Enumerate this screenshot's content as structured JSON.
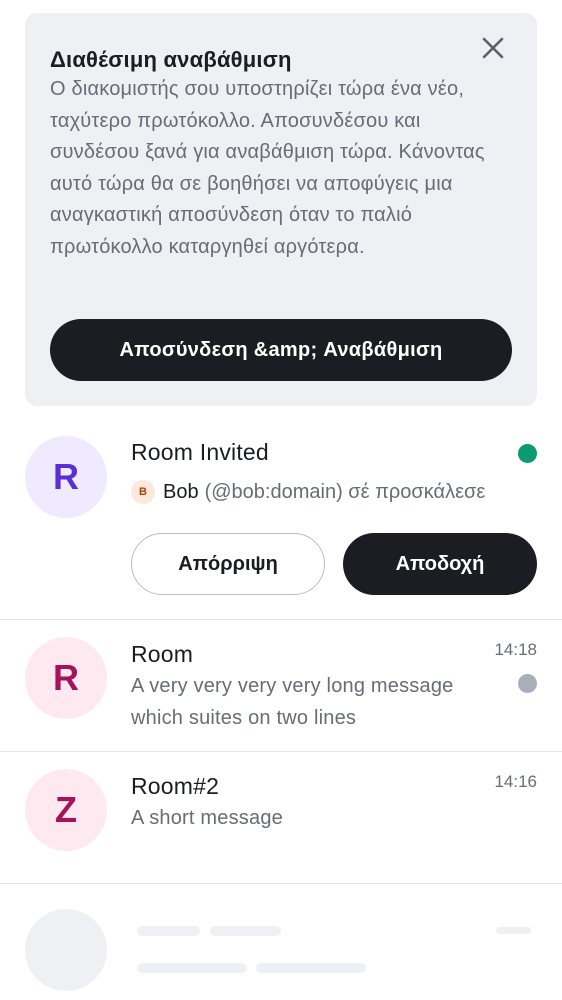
{
  "banner": {
    "title": "Διαθέσιμη αναβάθμιση",
    "body": "Ο διακομιστής σου υποστηρίζει τώρα ένα νέο, ταχύτερο πρωτόκολλο. Αποσυνδέσου και συνδέσου ξανά για αναβάθμιση τώρα. Κάνοντας αυτό τώρα θα σε βοηθήσει να αποφύγεις μια αναγκαστική αποσύνδεση όταν το παλιό πρωτόκολλο καταργηθεί αργότερα.",
    "button_label": "Αποσύνδεση &amp; Αναβάθμιση",
    "close_icon": "close-icon"
  },
  "invite": {
    "avatar_letter": "R",
    "avatar_colors": {
      "bg": "#efeafd",
      "fg": "#5a2fd6"
    },
    "room_name": "Room Invited",
    "indicator_color": "#0b9b73",
    "inviter_avatar_letter": "B",
    "inviter_name": "Bob",
    "inviter_rest": "(@bob:domain) σέ προσκάλεσε",
    "decline_label": "Απόρριψη",
    "accept_label": "Αποδοχή"
  },
  "rooms": [
    {
      "avatar_letter": "R",
      "avatar_colors": {
        "bg": "#fde9ef",
        "fg": "#a7135a"
      },
      "name": "Room",
      "timestamp": "14:18",
      "message": "A very very very very long message which suites on two lines",
      "unread_indicator_color": "#a9afb9"
    },
    {
      "avatar_letter": "Z",
      "avatar_colors": {
        "bg": "#fde9ef",
        "fg": "#a7135a"
      },
      "name": "Room#2",
      "timestamp": "14:16",
      "message": "A short message"
    }
  ],
  "colors": {
    "primary": "#1b1d22",
    "secondary_text": "#656d77",
    "banner_bg": "#eef0f4",
    "divider": "#e4e6ea"
  }
}
